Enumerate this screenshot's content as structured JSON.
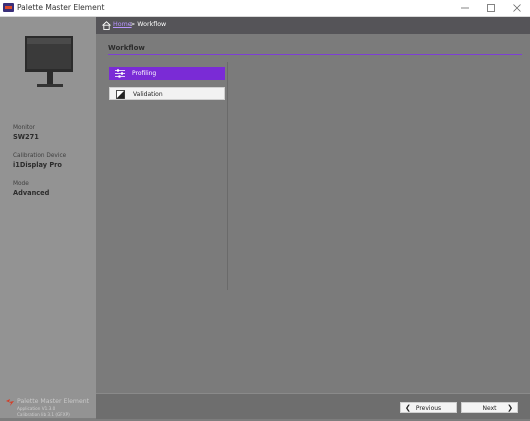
{
  "window": {
    "title": "Palette Master Element",
    "controls": [
      "minimize",
      "maximize",
      "close"
    ]
  },
  "sidebar": {
    "monitor_label": "Monitor",
    "monitor_value": "SW271",
    "device_label": "Calibration Device",
    "device_value": "i1Display Pro",
    "mode_label": "Mode",
    "mode_value": "Advanced",
    "brand_name": "Palette Master Element",
    "version_line1": "Application V1.3.0",
    "version_line2": "Calibration lib 3.1 (GFXP)"
  },
  "breadcrumb": {
    "home": "Home",
    "current": "> Workflow"
  },
  "main": {
    "section_title": "Workflow",
    "items": [
      {
        "label": "Profiling",
        "icon": "sliders-icon",
        "selected": true
      },
      {
        "label": "Validation",
        "icon": "contrast-icon",
        "selected": false
      }
    ]
  },
  "footer": {
    "previous_label": "Previous",
    "next_label": "Next"
  },
  "colors": {
    "accent": "#7a2bd6",
    "sidebar_bg": "#939393",
    "main_bg": "#7b7b7b",
    "breadcrumb_bg": "#555458"
  }
}
